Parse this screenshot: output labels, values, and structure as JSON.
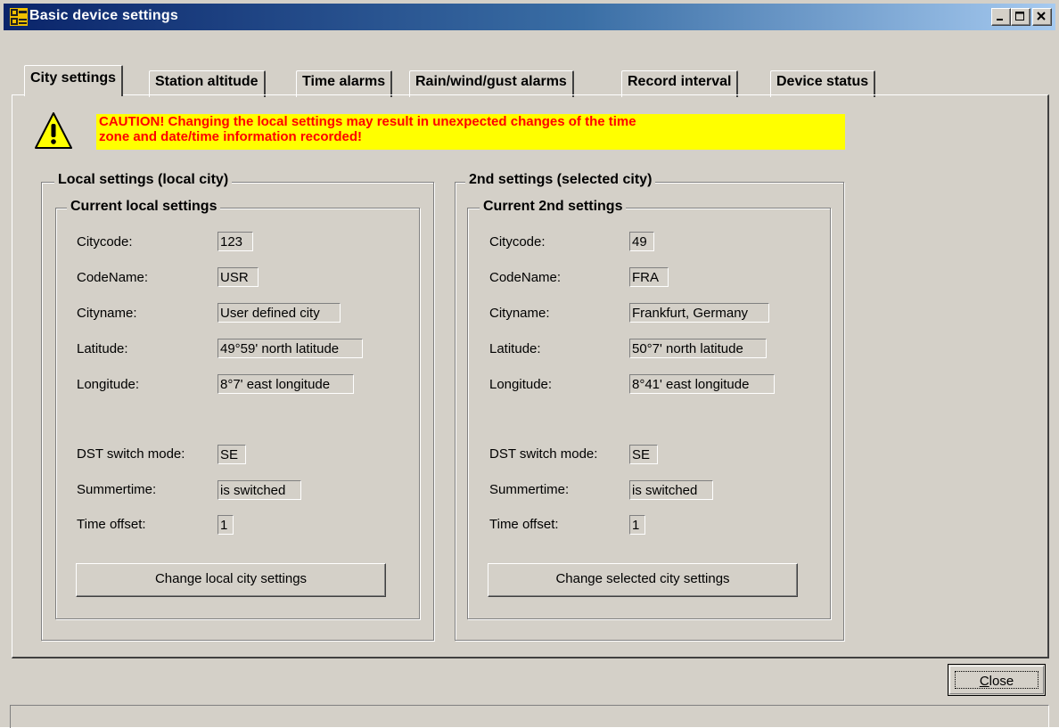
{
  "window": {
    "title": "Basic device settings",
    "controls": {
      "minimize": "minimize",
      "maximize": "maximize",
      "close": "close"
    }
  },
  "tabs": [
    {
      "label": "City settings",
      "active": true
    },
    {
      "label": "Station altitude",
      "active": false
    },
    {
      "label": "Time alarms",
      "active": false
    },
    {
      "label": "Rain/wind/gust alarms",
      "active": false
    },
    {
      "label": "Record interval",
      "active": false
    },
    {
      "label": "Device status",
      "active": false
    }
  ],
  "warning": {
    "line1": "CAUTION! Changing the local settings may result in unexpected changes of the time",
    "line2": "zone and date/time information recorded!"
  },
  "local": {
    "group_title": "Local settings (local city)",
    "subgroup_title": "Current local settings",
    "fields": {
      "citycode": {
        "label": "Citycode:",
        "value": "123"
      },
      "codename": {
        "label": "CodeName:",
        "value": "USR"
      },
      "cityname": {
        "label": "Cityname:",
        "value": "User defined city"
      },
      "latitude": {
        "label": "Latitude:",
        "value": "49°59' north latitude"
      },
      "longitude": {
        "label": "Longitude:",
        "value": "8°7' east longitude"
      },
      "dst": {
        "label": "DST switch mode:",
        "value": "SE"
      },
      "summertime": {
        "label": "Summertime:",
        "value": "is switched"
      },
      "offset": {
        "label": "Time offset:",
        "value": "1"
      }
    },
    "button_label": "Change local city settings"
  },
  "second": {
    "group_title": "2nd settings (selected city)",
    "subgroup_title": "Current 2nd settings",
    "fields": {
      "citycode": {
        "label": "Citycode:",
        "value": "49"
      },
      "codename": {
        "label": "CodeName:",
        "value": "FRA"
      },
      "cityname": {
        "label": "Cityname:",
        "value": "Frankfurt, Germany"
      },
      "latitude": {
        "label": "Latitude:",
        "value": "50°7' north latitude"
      },
      "longitude": {
        "label": "Longitude:",
        "value": "8°41' east longitude"
      },
      "dst": {
        "label": "DST switch mode:",
        "value": "SE"
      },
      "summertime": {
        "label": "Summertime:",
        "value": "is switched"
      },
      "offset": {
        "label": "Time offset:",
        "value": "1"
      }
    },
    "button_label": "Change selected city settings"
  },
  "footer": {
    "close_label": "Close"
  },
  "colors": {
    "window_bg": "#d4d0c8",
    "title_start": "#0a246a",
    "title_end": "#a6caf0",
    "warning_bg": "#ffff00",
    "warning_text": "#ff0000"
  }
}
